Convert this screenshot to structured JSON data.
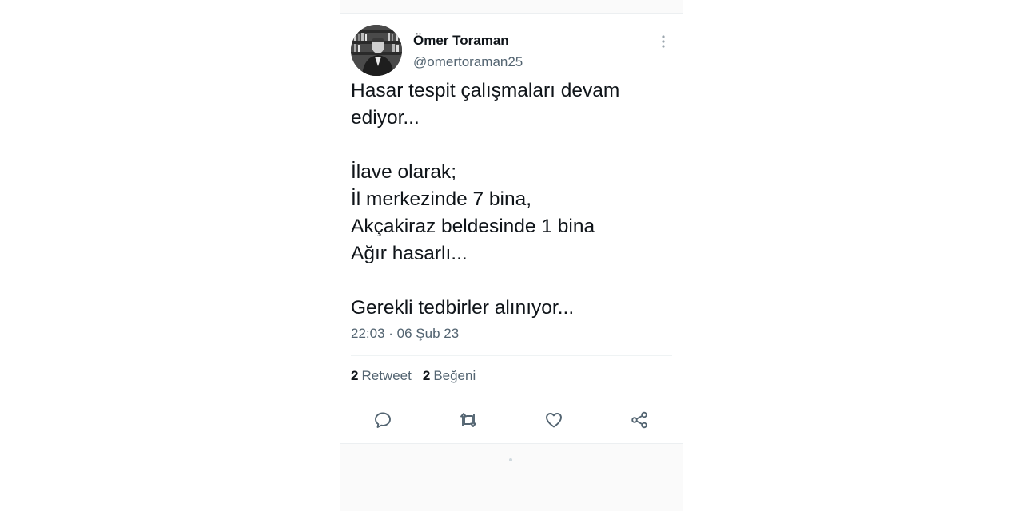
{
  "tweet": {
    "author": {
      "name": "Ömer Toraman",
      "handle": "@omertoraman25",
      "avatar": "author-avatar-photo"
    },
    "text_lines": [
      "Hasar tespit çalışmaları devam",
      "ediyor...",
      "",
      "İlave olarak;",
      "İl merkezinde 7 bina,",
      "Akçakiraz beldesinde 1 bina",
      "Ağır hasarlı...",
      "",
      "Gerekli tedbirler alınıyor..."
    ],
    "timestamp": "22:03 · 06 Şub 23",
    "stats": {
      "retweets_count": "2",
      "retweets_label": "Retweet",
      "likes_count": "2",
      "likes_label": "Beğeni"
    },
    "actions": {
      "reply_icon": "reply-icon",
      "retweet_icon": "retweet-icon",
      "like_icon": "heart-icon",
      "share_icon": "share-icon",
      "more_icon": "more-vertical-icon"
    }
  },
  "colors": {
    "text_primary": "#0f1419",
    "text_secondary": "#536471",
    "icon": "#536471",
    "divider": "#eff3f4",
    "background": "#ffffff"
  }
}
